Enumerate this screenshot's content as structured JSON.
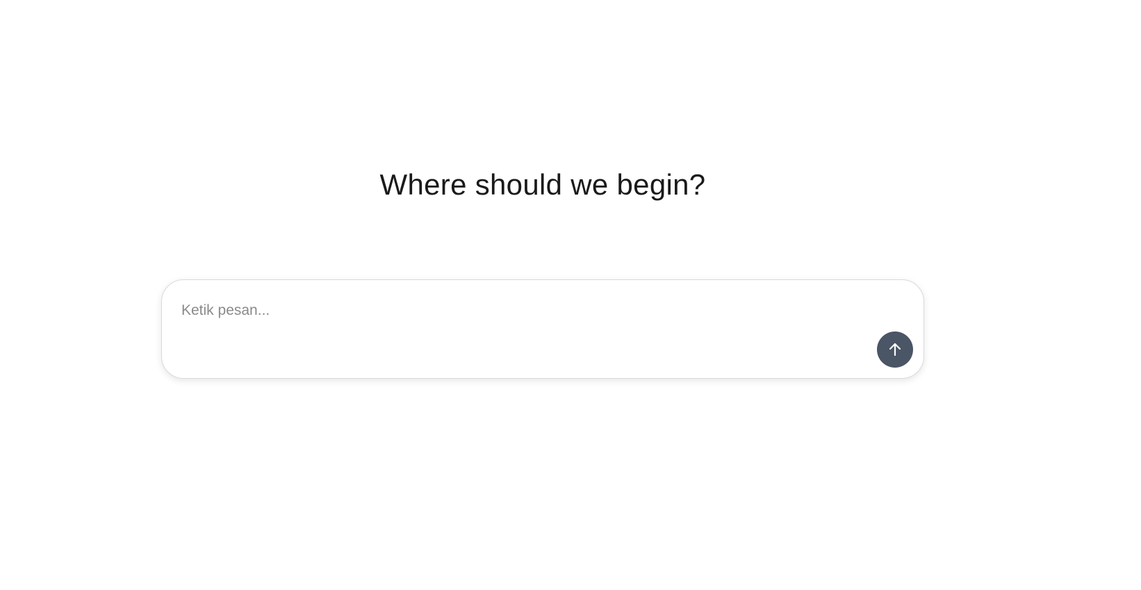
{
  "main": {
    "heading": "Where should we begin?"
  },
  "composer": {
    "placeholder": "Ketik pesan...",
    "value": "",
    "send_icon": "arrow-up-icon"
  },
  "colors": {
    "send_button": "#4a5565",
    "heading_text": "#1a1a1a",
    "placeholder_text": "#8a8a8a",
    "composer_border": "#d9d9d9"
  }
}
